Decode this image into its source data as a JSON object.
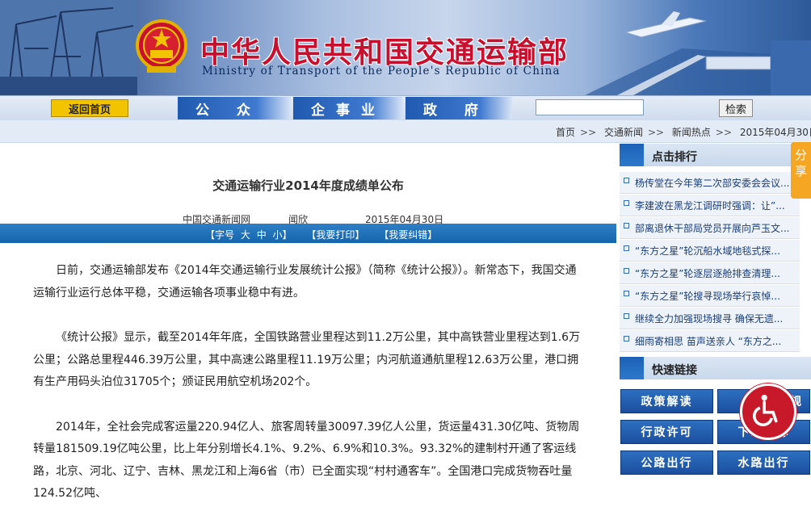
{
  "header": {
    "title_cn": "中华人民共和国交通运输部",
    "title_en": "Ministry of Transport of the People's Republic of China"
  },
  "nav": {
    "home": "返回首页",
    "tabs": [
      "公 众",
      "企事业",
      "政 府"
    ],
    "search_placeholder": "",
    "search_button": "检索"
  },
  "breadcrumb": [
    "首页",
    "交通新闻",
    "新闻热点",
    "2015年04月30日"
  ],
  "article": {
    "title": "交通运输行业2014年度成绩单公布",
    "source": "中国交通新闻网",
    "author": "闻欣",
    "date": "2015年04月30日",
    "toolbar": {
      "font_label": "【字号",
      "font_large": "大",
      "font_medium": "中",
      "font_small": "小】",
      "print": "【我要打印】",
      "correct": "【我要纠错】"
    },
    "paragraphs": [
      "日前，交通运输部发布《2014年交通运输行业发展统计公报》（简称《统计公报》）。新常态下，我国交通运输行业运行总体平稳，交通运输各项事业稳中有进。",
      "《统计公报》显示，截至2014年年底，全国铁路营业里程达到11.2万公里，其中高铁营业里程达到1.6万公里；公路总里程446.39万公里，其中高速公路里程11.19万公里；内河航道通航里程12.63万公里，港口拥有生产用码头泊位31705个；颁证民用航空机场202个。",
      "2014年，全社会完成客运量220.94亿人、旅客周转量30097.39亿人公里，货运量431.30亿吨、货物周转量181509.19亿吨公里，比上年分别增长4.1%、9.2%、6.9%和10.3%。93.32%的建制村开通了客运线路，北京、河北、辽宁、吉林、黑龙江和上海6省（市）已全面实现“村村通客车”。全国港口完成货物吞吐量124.52亿吨、"
    ]
  },
  "sidebar": {
    "ranking_title": "点击排行",
    "ranking": [
      "杨传堂在今年第二次部安委会会议...",
      "李建波在黑龙江调研时强调：让”...",
      "部离退休干部局党员开展向芦玉文...",
      "“东方之星”轮沉船水域地毯式探...",
      "“东方之星”轮逐层逐舱排查清理...",
      "“东方之星”轮搜寻现场举行哀悼...",
      "继续全力加强现场搜寻 确保无遗...",
      "细雨寄相思 苗声送亲人 “东方之..."
    ],
    "links_title": "快速链接",
    "links": [
      "政策解读",
      "规",
      "行政许可",
      "下载中心",
      "公路出行",
      "水路出行"
    ]
  },
  "share": "分享",
  "colors": {
    "brand_red": "#c8102e",
    "nav_blue": "#1f5ab0",
    "accent_yellow": "#f2c400",
    "share_orange": "#f5a623"
  }
}
